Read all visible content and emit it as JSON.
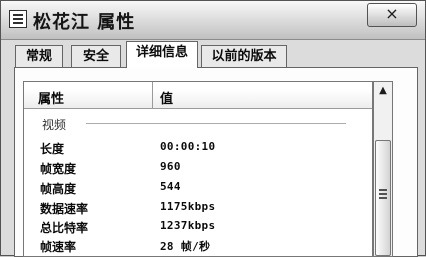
{
  "window": {
    "title": "松花江 属性",
    "close_glyph": "×"
  },
  "tabs": [
    "常规",
    "安全",
    "详细信息",
    "以前的版本"
  ],
  "active_tab": 2,
  "list": {
    "columns": [
      "属性",
      "值"
    ],
    "group_label": "视频",
    "rows": [
      {
        "key": "长度",
        "value": "00:00:10"
      },
      {
        "key": "帧宽度",
        "value": "960"
      },
      {
        "key": "帧高度",
        "value": "544"
      },
      {
        "key": "数据速率",
        "value": "1175kbps"
      },
      {
        "key": "总比特率",
        "value": "1237kbps"
      },
      {
        "key": "帧速率",
        "value": "28 帧/秒"
      }
    ]
  },
  "scrollbar": {
    "up_arrow": "▲"
  }
}
